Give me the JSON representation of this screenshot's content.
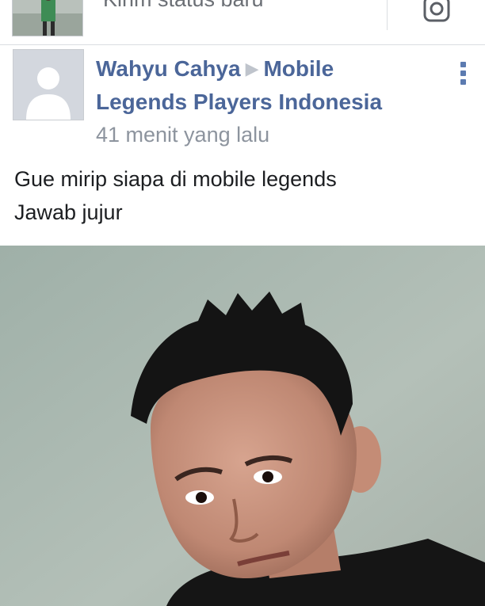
{
  "composer": {
    "prompt": "Kirim status baru",
    "camera_icon": "camera-icon"
  },
  "post": {
    "author": "Wahyu Cahya",
    "separator_icon": "triangle-right-icon",
    "group": "Mobile Legends Players Indonesia",
    "time": "41 menit yang lalu",
    "more_icon": "more-vertical-icon",
    "text_line1": "Gue mirip siapa di mobile legends",
    "text_line2": "Jawab jujur"
  },
  "colors": {
    "link": "#4b6699",
    "meta": "#8d949e",
    "text": "#1c1e21",
    "wall": "#a8b5ad"
  }
}
